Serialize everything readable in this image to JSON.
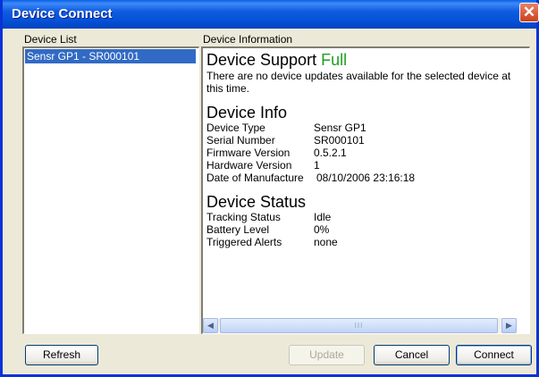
{
  "window": {
    "title": "Device Connect",
    "close_glyph": "✕"
  },
  "device_list": {
    "label": "Device List",
    "items": [
      "Sensr GP1 - SR000101"
    ]
  },
  "device_information": {
    "label": "Device Information",
    "support_heading": "Device Support",
    "support_status": "Full",
    "support_message": "There are no device updates available for the selected device at this time.",
    "info_heading": "Device Info",
    "info_rows": [
      {
        "key": "Device Type",
        "value": "Sensr GP1"
      },
      {
        "key": "Serial Number",
        "value": "SR000101"
      },
      {
        "key": "Firmware Version",
        "value": "0.5.2.1"
      },
      {
        "key": "Hardware Version",
        "value": "1"
      },
      {
        "key": "Date of Manufacture",
        "value": "08/10/2006 23:16:18"
      }
    ],
    "status_heading": "Device Status",
    "status_rows": [
      {
        "key": "Tracking Status",
        "value": "Idle"
      },
      {
        "key": "Battery Level",
        "value": "0%"
      },
      {
        "key": "Triggered Alerts",
        "value": "none"
      }
    ],
    "scroll_left_glyph": "◀",
    "scroll_right_glyph": "▶",
    "scroll_grip_glyph": "III"
  },
  "buttons": {
    "refresh": "Refresh",
    "update": "Update",
    "cancel": "Cancel",
    "connect": "Connect"
  },
  "icons": {
    "close": "close-icon",
    "scroll_left": "arrow-left-icon",
    "scroll_right": "arrow-right-icon"
  }
}
